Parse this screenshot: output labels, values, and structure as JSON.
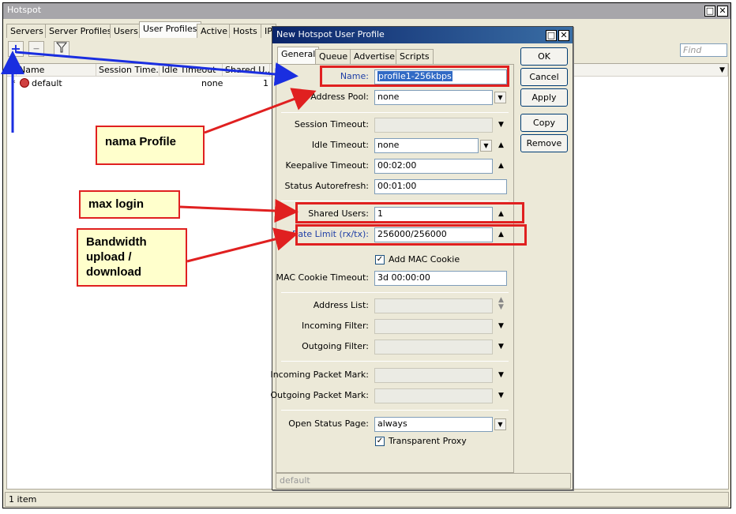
{
  "main": {
    "title": "Hotspot",
    "tabs": [
      "Servers",
      "Server Profiles",
      "Users",
      "User Profiles",
      "Active",
      "Hosts",
      "IP"
    ],
    "find_placeholder": "Find",
    "columns": [
      "Name",
      "Session Time...",
      "Idle Timeout",
      "Shared U..."
    ],
    "rows": [
      {
        "marker": "*",
        "name": "default",
        "session_timeout": "",
        "idle_timeout": "none",
        "shared_users": "1"
      }
    ],
    "status": "1 item"
  },
  "dialog": {
    "title": "New Hotspot User Profile",
    "tabs": [
      "General",
      "Queue",
      "Advertise",
      "Scripts"
    ],
    "fields": {
      "name": {
        "label": "Name:",
        "value": "profile1-256kbps"
      },
      "address_pool": {
        "label": "Address Pool:",
        "value": "none"
      },
      "session_timeout": {
        "label": "Session Timeout:",
        "value": ""
      },
      "idle_timeout": {
        "label": "Idle Timeout:",
        "value": "none"
      },
      "keepalive_timeout": {
        "label": "Keepalive Timeout:",
        "value": "00:02:00"
      },
      "status_autorefresh": {
        "label": "Status Autorefresh:",
        "value": "00:01:00"
      },
      "shared_users": {
        "label": "Shared Users:",
        "value": "1"
      },
      "rate_limit": {
        "label": "Rate Limit (rx/tx):",
        "value": "256000/256000"
      },
      "add_mac_cookie": {
        "label": "Add MAC Cookie",
        "checked": true
      },
      "mac_cookie_timeout": {
        "label": "MAC Cookie Timeout:",
        "value": "3d 00:00:00"
      },
      "address_list": {
        "label": "Address List:",
        "value": ""
      },
      "incoming_filter": {
        "label": "Incoming Filter:",
        "value": ""
      },
      "outgoing_filter": {
        "label": "Outgoing Filter:",
        "value": ""
      },
      "incoming_packet_mark": {
        "label": "Incoming Packet Mark:",
        "value": ""
      },
      "outgoing_packet_mark": {
        "label": "Outgoing Packet Mark:",
        "value": ""
      },
      "open_status_page": {
        "label": "Open Status Page:",
        "value": "always"
      },
      "transparent_proxy": {
        "label": "Transparent Proxy",
        "checked": true
      }
    },
    "buttons": {
      "ok": "OK",
      "cancel": "Cancel",
      "apply": "Apply",
      "copy": "Copy",
      "remove": "Remove"
    },
    "status": "default"
  },
  "annotations": {
    "nama_profile": "nama Profile",
    "max_login": "max login",
    "bandwidth_line1": "Bandwidth",
    "bandwidth_line2": "upload /",
    "bandwidth_line3": "download",
    "color_red": "#e02020",
    "color_blue": "#1a2ee0"
  },
  "icons": {
    "add": "plus-icon",
    "remove": "minus-icon",
    "filter": "filter-icon",
    "close": "close-icon",
    "maximize": "maximize-icon",
    "profile": "profile-icon"
  }
}
